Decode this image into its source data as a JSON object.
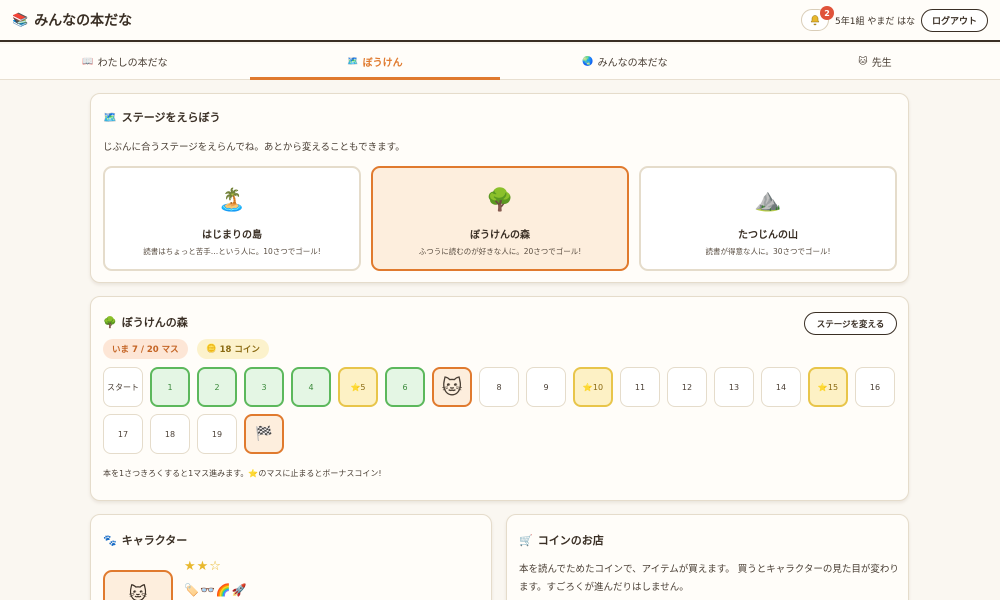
{
  "app": {
    "title": "みんなの本だな",
    "logo_icon": "books-icon",
    "notification_count": "2",
    "user_name": "5年1組 やまだ はな",
    "logout_label": "ログアウト"
  },
  "tabs": [
    {
      "icon": "📖",
      "label": "わたしの本だな",
      "active": false
    },
    {
      "icon": "🗺️",
      "label": "ぼうけん",
      "active": true
    },
    {
      "icon": "🌏",
      "label": "みんなの本だな",
      "active": false
    },
    {
      "icon": "🐱",
      "label": "先生",
      "active": false
    }
  ],
  "stage_select": {
    "icon": "🗺️",
    "title": "ステージをえらぼう",
    "description": "じぶんに合うステージをえらんでね。あとから変えることもできます。",
    "options": [
      {
        "emoji": "🏝️",
        "name": "はじまりの島",
        "info": "読書はちょっと苦手…という人に。10さつでゴール!",
        "selected": false
      },
      {
        "emoji": "🌳",
        "name": "ぼうけんの森",
        "info": "ふつうに読むのが好きな人に。20さつでゴール!",
        "selected": true
      },
      {
        "emoji": "⛰️",
        "name": "たつじんの山",
        "info": "読書が得意な人に。30さつでゴール!",
        "selected": false
      }
    ]
  },
  "board": {
    "icon": "🌳",
    "title": "ぼうけんの森",
    "change_label": "ステージを変える",
    "position_label": "いま 7 / 20 マス",
    "coin_icon": "🪙",
    "coin_label": "18 コイン",
    "cells": [
      {
        "label": "スタート",
        "state": "start"
      },
      {
        "label": "1",
        "state": "done"
      },
      {
        "label": "2",
        "state": "done"
      },
      {
        "label": "3",
        "state": "done"
      },
      {
        "label": "4",
        "state": "done"
      },
      {
        "label": "⭐5",
        "state": "bonus"
      },
      {
        "label": "6",
        "state": "done"
      },
      {
        "label": "🐱",
        "state": "current"
      },
      {
        "label": "8",
        "state": "empty"
      },
      {
        "label": "9",
        "state": "empty"
      },
      {
        "label": "⭐10",
        "state": "bonus"
      },
      {
        "label": "11",
        "state": "empty"
      },
      {
        "label": "12",
        "state": "empty"
      },
      {
        "label": "13",
        "state": "empty"
      },
      {
        "label": "14",
        "state": "empty"
      },
      {
        "label": "⭐15",
        "state": "bonus"
      },
      {
        "label": "16",
        "state": "empty"
      },
      {
        "label": "17",
        "state": "empty"
      },
      {
        "label": "18",
        "state": "empty"
      },
      {
        "label": "19",
        "state": "empty"
      },
      {
        "label": "🏁",
        "state": "goal"
      }
    ],
    "note": "本を1さつきろくすると1マス進みます。⭐のマスに止まるとボーナスコイン!"
  },
  "character": {
    "icon": "🐾",
    "title": "キャラクター",
    "stars": "★★☆",
    "items": "🏷️👓🌈🚀",
    "avatar": "🐱"
  },
  "shop": {
    "icon": "🛒",
    "title": "コインのお店",
    "description": "本を読んでためたコインで、アイテムが買えます。 買うとキャラクターの見た目が変わります。すごろくが進んだりはしません。"
  }
}
